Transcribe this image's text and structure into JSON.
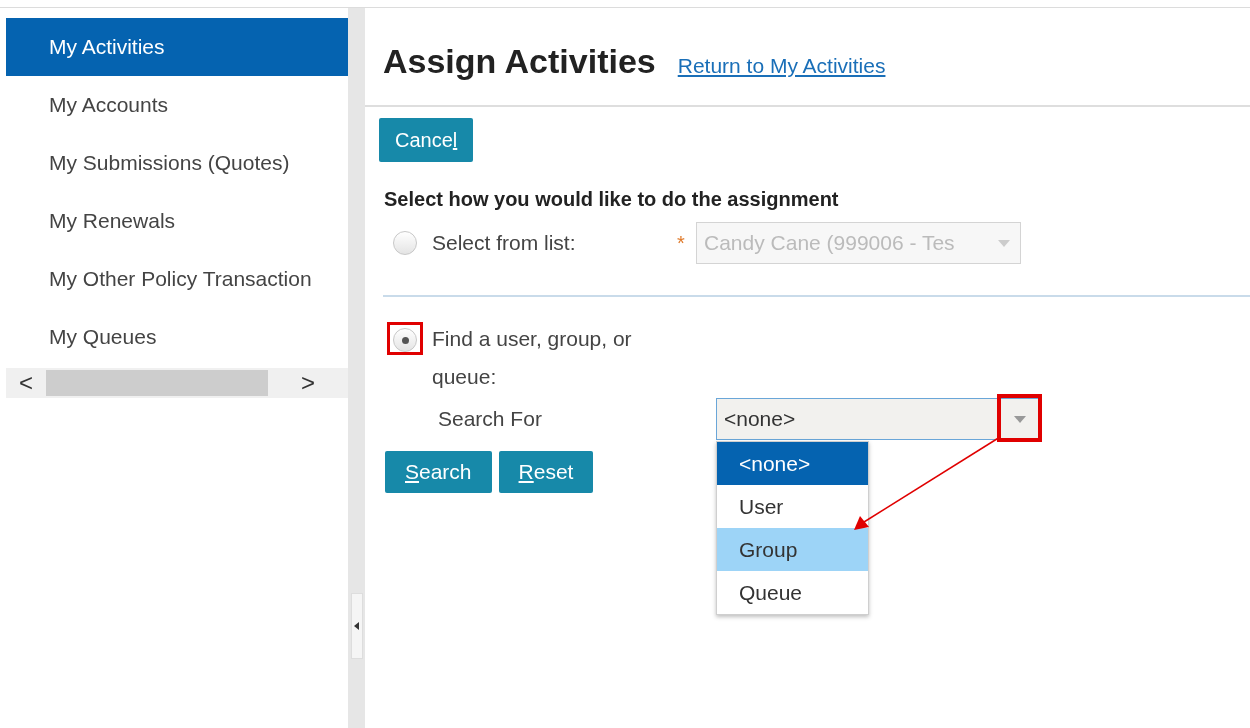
{
  "sidebar": {
    "items": [
      {
        "label": "My Activities",
        "selected": true
      },
      {
        "label": "My Accounts",
        "selected": false
      },
      {
        "label": "My Submissions (Quotes)",
        "selected": false
      },
      {
        "label": "My Renewals",
        "selected": false
      },
      {
        "label": "My Other Policy Transaction",
        "selected": false
      },
      {
        "label": "My Queues",
        "selected": false
      }
    ],
    "scroll_left": "<",
    "scroll_right": ">"
  },
  "page": {
    "title": "Assign Activities",
    "return_link": "Return to My Activities"
  },
  "cancel_button": {
    "before": "Cance",
    "access_key": "l"
  },
  "section_heading": "Select how you would like to do the assignment",
  "select_from_list": {
    "label": "Select from list:",
    "selected": false,
    "required_mark": "*",
    "value": "Candy Cane (999006 - Tes",
    "disabled": true
  },
  "find": {
    "label": "Find a user, group, or queue:",
    "selected": true,
    "search_for_label": "Search For",
    "value": "<none>",
    "options": [
      {
        "label": "<none>",
        "selected": true,
        "hovered": false
      },
      {
        "label": "User",
        "selected": false,
        "hovered": false
      },
      {
        "label": "Group",
        "selected": false,
        "hovered": true
      },
      {
        "label": "Queue",
        "selected": false,
        "hovered": false
      }
    ]
  },
  "action_buttons": [
    {
      "access_key": "S",
      "after": "earch"
    },
    {
      "access_key": "R",
      "after": "eset"
    }
  ],
  "annotations": {
    "highlight_radio": true,
    "highlight_dropdown_button": true,
    "arrow_to_option": true
  }
}
